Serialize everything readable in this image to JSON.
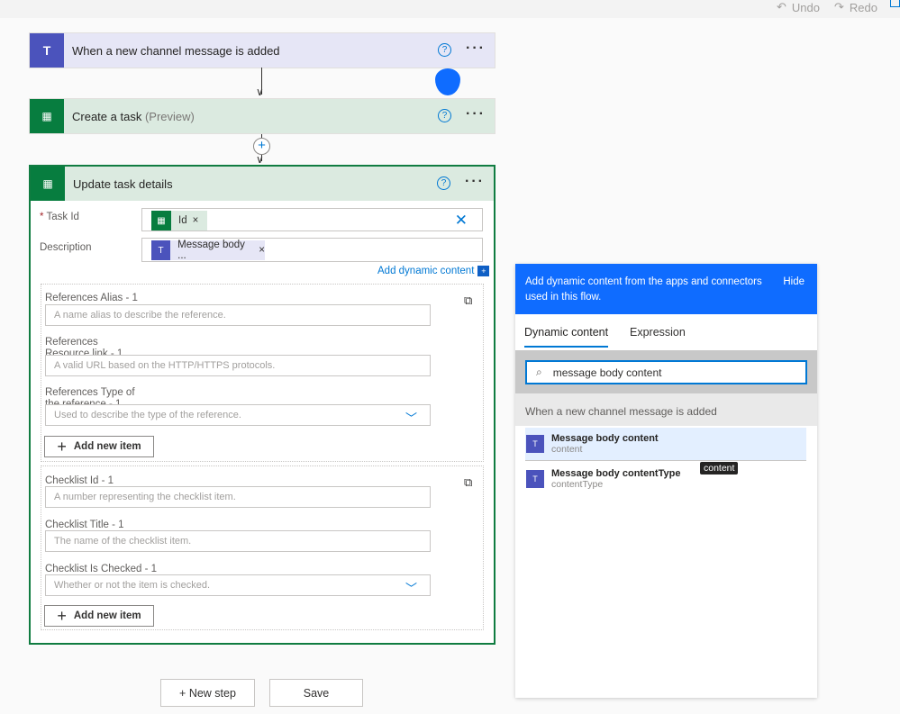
{
  "toolbar": {
    "undo": "Undo",
    "redo": "Redo"
  },
  "colors": {
    "teams": "#4b53bc",
    "planner": "#077d3f",
    "accent": "#0f6cff"
  },
  "steps": [
    {
      "title": "When a new channel message is added",
      "icon": "teams-icon"
    },
    {
      "title": "Create a task",
      "suffix": "(Preview)",
      "icon": "planner-icon"
    },
    {
      "title": "Update task details",
      "icon": "planner-icon"
    }
  ],
  "form": {
    "task_id_label": "Task Id",
    "required_mark": "*",
    "task_id_token": "Id",
    "description_label": "Description",
    "description_token": "Message body ...",
    "add_dynamic": "Add dynamic content",
    "references": {
      "alias_label": "References Alias - 1",
      "alias_placeholder": "A name alias to describe the reference.",
      "link_label": "References Resource link - 1",
      "link_placeholder": "A valid URL based on the HTTP/HTTPS protocols.",
      "type_label": "References Type of the reference - 1",
      "type_placeholder": "Used to describe the type of the reference.",
      "add": "Add new item"
    },
    "checklist": {
      "id_label": "Checklist Id - 1",
      "id_placeholder": "A number representing the checklist item.",
      "title_label": "Checklist Title - 1",
      "title_placeholder": "The name of the checklist item.",
      "checked_label": "Checklist Is Checked - 1",
      "checked_placeholder": "Whether or not the item is checked.",
      "add": "Add new item"
    }
  },
  "footer": {
    "new_step": "+ New step",
    "save": "Save"
  },
  "panel": {
    "header": "Add dynamic content from the apps and connectors used in this flow.",
    "hide": "Hide",
    "tabs": [
      "Dynamic content",
      "Expression"
    ],
    "search_value": "message body content",
    "group": "When a new channel message is added",
    "items": [
      {
        "title": "Message body content",
        "sub": "content"
      },
      {
        "title": "Message body contentType",
        "sub": "contentType"
      }
    ],
    "tooltip": "content"
  }
}
